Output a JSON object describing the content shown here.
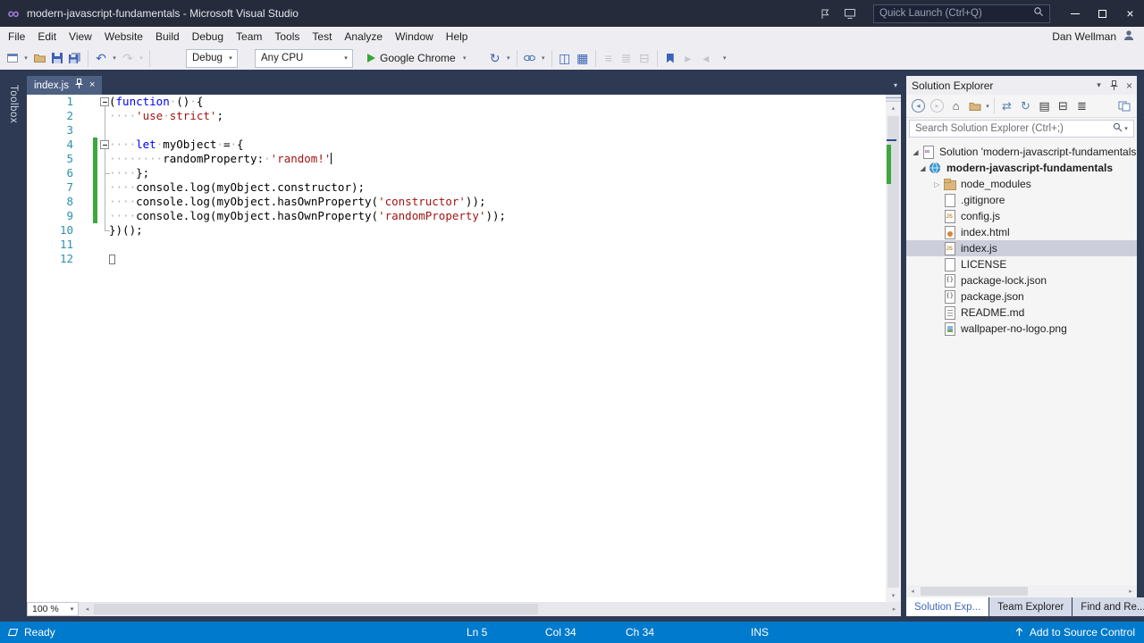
{
  "colors": {
    "accent_blue": "#007ACC",
    "window_bg": "#2E3A54",
    "chrome_light": "#EEEEF2",
    "keyword": "#0000FF",
    "string": "#A31515",
    "line_number": "#2B91AF",
    "change_bar_green": "#3FA73F"
  },
  "icons": {
    "vs_logo": "∞",
    "close": "×",
    "caret_down": "▾",
    "scroll_up": "▴",
    "scroll_down": "▾",
    "scroll_left": "◂",
    "scroll_right": "▸",
    "undo": "↶",
    "redo": "↷",
    "browser_refresh": "↻",
    "sync": "⇄",
    "home": "⌂",
    "nav_back": "◂",
    "nav_forward": "▸",
    "grid": "▦",
    "split": "◫",
    "list": "≡",
    "properties": "≣",
    "collapse_all": "⊟",
    "show_all_files": "▤",
    "tree_expanded": "◢",
    "tree_collapsed": "▷"
  },
  "title_bar": {
    "title": "modern-javascript-fundamentals - Microsoft Visual Studio",
    "quick_launch_placeholder": "Quick Launch (Ctrl+Q)"
  },
  "menu_bar": {
    "items": [
      "File",
      "Edit",
      "View",
      "Website",
      "Build",
      "Debug",
      "Team",
      "Tools",
      "Test",
      "Analyze",
      "Window",
      "Help"
    ],
    "user_name": "Dan Wellman"
  },
  "toolbar": {
    "debug_target": "Debug",
    "platform": "Any CPU",
    "run_label": "Google Chrome"
  },
  "toolbox_tab": "Toolbox",
  "editor": {
    "tab_label": "index.js",
    "zoom_level": "100 %",
    "code_lines": [
      {
        "n": 1,
        "fold": true,
        "seg": [
          [
            "p",
            "("
          ],
          [
            "k",
            "function"
          ],
          [
            "w",
            "·"
          ],
          [
            "p",
            "()"
          ],
          [
            "w",
            "·"
          ],
          [
            "p",
            "{"
          ]
        ]
      },
      {
        "n": 2,
        "seg": [
          [
            "w",
            "····"
          ],
          [
            "s",
            "'use"
          ],
          [
            "w",
            "·"
          ],
          [
            "s",
            "strict'"
          ],
          [
            "p",
            ";"
          ]
        ]
      },
      {
        "n": 3,
        "seg": []
      },
      {
        "n": 4,
        "fold": true,
        "changed": true,
        "seg": [
          [
            "w",
            "····"
          ],
          [
            "k",
            "let"
          ],
          [
            "w",
            "·"
          ],
          [
            "i",
            "myObject"
          ],
          [
            "w",
            "·"
          ],
          [
            "p",
            "="
          ],
          [
            "w",
            "·"
          ],
          [
            "p",
            "{"
          ]
        ]
      },
      {
        "n": 5,
        "changed": true,
        "caret": true,
        "seg": [
          [
            "w",
            "········"
          ],
          [
            "i",
            "randomProperty"
          ],
          [
            "p",
            ":"
          ],
          [
            "w",
            "·"
          ],
          [
            "s",
            "'random!'"
          ]
        ]
      },
      {
        "n": 6,
        "changed": true,
        "seg": [
          [
            "w",
            "····"
          ],
          [
            "p",
            "};"
          ]
        ]
      },
      {
        "n": 7,
        "changed": true,
        "seg": [
          [
            "w",
            "····"
          ],
          [
            "i",
            "console"
          ],
          [
            "p",
            "."
          ],
          [
            "i",
            "log"
          ],
          [
            "p",
            "("
          ],
          [
            "i",
            "myObject"
          ],
          [
            "p",
            "."
          ],
          [
            "i",
            "constructor"
          ],
          [
            "p",
            ");"
          ]
        ]
      },
      {
        "n": 8,
        "changed": true,
        "seg": [
          [
            "w",
            "····"
          ],
          [
            "i",
            "console"
          ],
          [
            "p",
            "."
          ],
          [
            "i",
            "log"
          ],
          [
            "p",
            "("
          ],
          [
            "i",
            "myObject"
          ],
          [
            "p",
            "."
          ],
          [
            "i",
            "hasOwnProperty"
          ],
          [
            "p",
            "("
          ],
          [
            "s",
            "'constructor'"
          ],
          [
            "p",
            "));"
          ]
        ]
      },
      {
        "n": 9,
        "changed": true,
        "seg": [
          [
            "w",
            "····"
          ],
          [
            "i",
            "console"
          ],
          [
            "p",
            "."
          ],
          [
            "i",
            "log"
          ],
          [
            "p",
            "("
          ],
          [
            "i",
            "myObject"
          ],
          [
            "p",
            "."
          ],
          [
            "i",
            "hasOwnProperty"
          ],
          [
            "p",
            "("
          ],
          [
            "s",
            "'randomProperty'"
          ],
          [
            "p",
            "));"
          ]
        ]
      },
      {
        "n": 10,
        "seg": [
          [
            "p",
            "})();"
          ]
        ]
      },
      {
        "n": 11,
        "seg": []
      },
      {
        "n": 12,
        "eof": true,
        "seg": []
      }
    ]
  },
  "solution_explorer": {
    "title": "Solution Explorer",
    "search_placeholder": "Search Solution Explorer (Ctrl+;)",
    "tree": [
      {
        "label": "Solution 'modern-javascript-fundamentals'",
        "icon": "solution",
        "level": 0,
        "expand": "open"
      },
      {
        "label": "modern-javascript-fundamentals",
        "icon": "project",
        "level": 1,
        "expand": "open",
        "bold": true
      },
      {
        "label": "node_modules",
        "icon": "folder",
        "level": 2,
        "expand": "closed"
      },
      {
        "label": ".gitignore",
        "icon": "file",
        "level": 2
      },
      {
        "label": "config.js",
        "icon": "js",
        "level": 2
      },
      {
        "label": "index.html",
        "icon": "html",
        "level": 2
      },
      {
        "label": "index.js",
        "icon": "js",
        "level": 2,
        "selected": true
      },
      {
        "label": "LICENSE",
        "icon": "file",
        "level": 2
      },
      {
        "label": "package-lock.json",
        "icon": "json",
        "level": 2
      },
      {
        "label": "package.json",
        "icon": "json",
        "level": 2
      },
      {
        "label": "README.md",
        "icon": "md",
        "level": 2
      },
      {
        "label": "wallpaper-no-logo.png",
        "icon": "image",
        "level": 2
      }
    ],
    "bottom_tabs": [
      {
        "label": "Solution Exp...",
        "active": true
      },
      {
        "label": "Team Explorer",
        "active": false
      },
      {
        "label": "Find and Re...",
        "active": false
      }
    ]
  },
  "status_bar": {
    "status": "Ready",
    "line": "Ln 5",
    "column": "Col 34",
    "character": "Ch 34",
    "mode": "INS",
    "source_control": "Add to Source Control"
  }
}
